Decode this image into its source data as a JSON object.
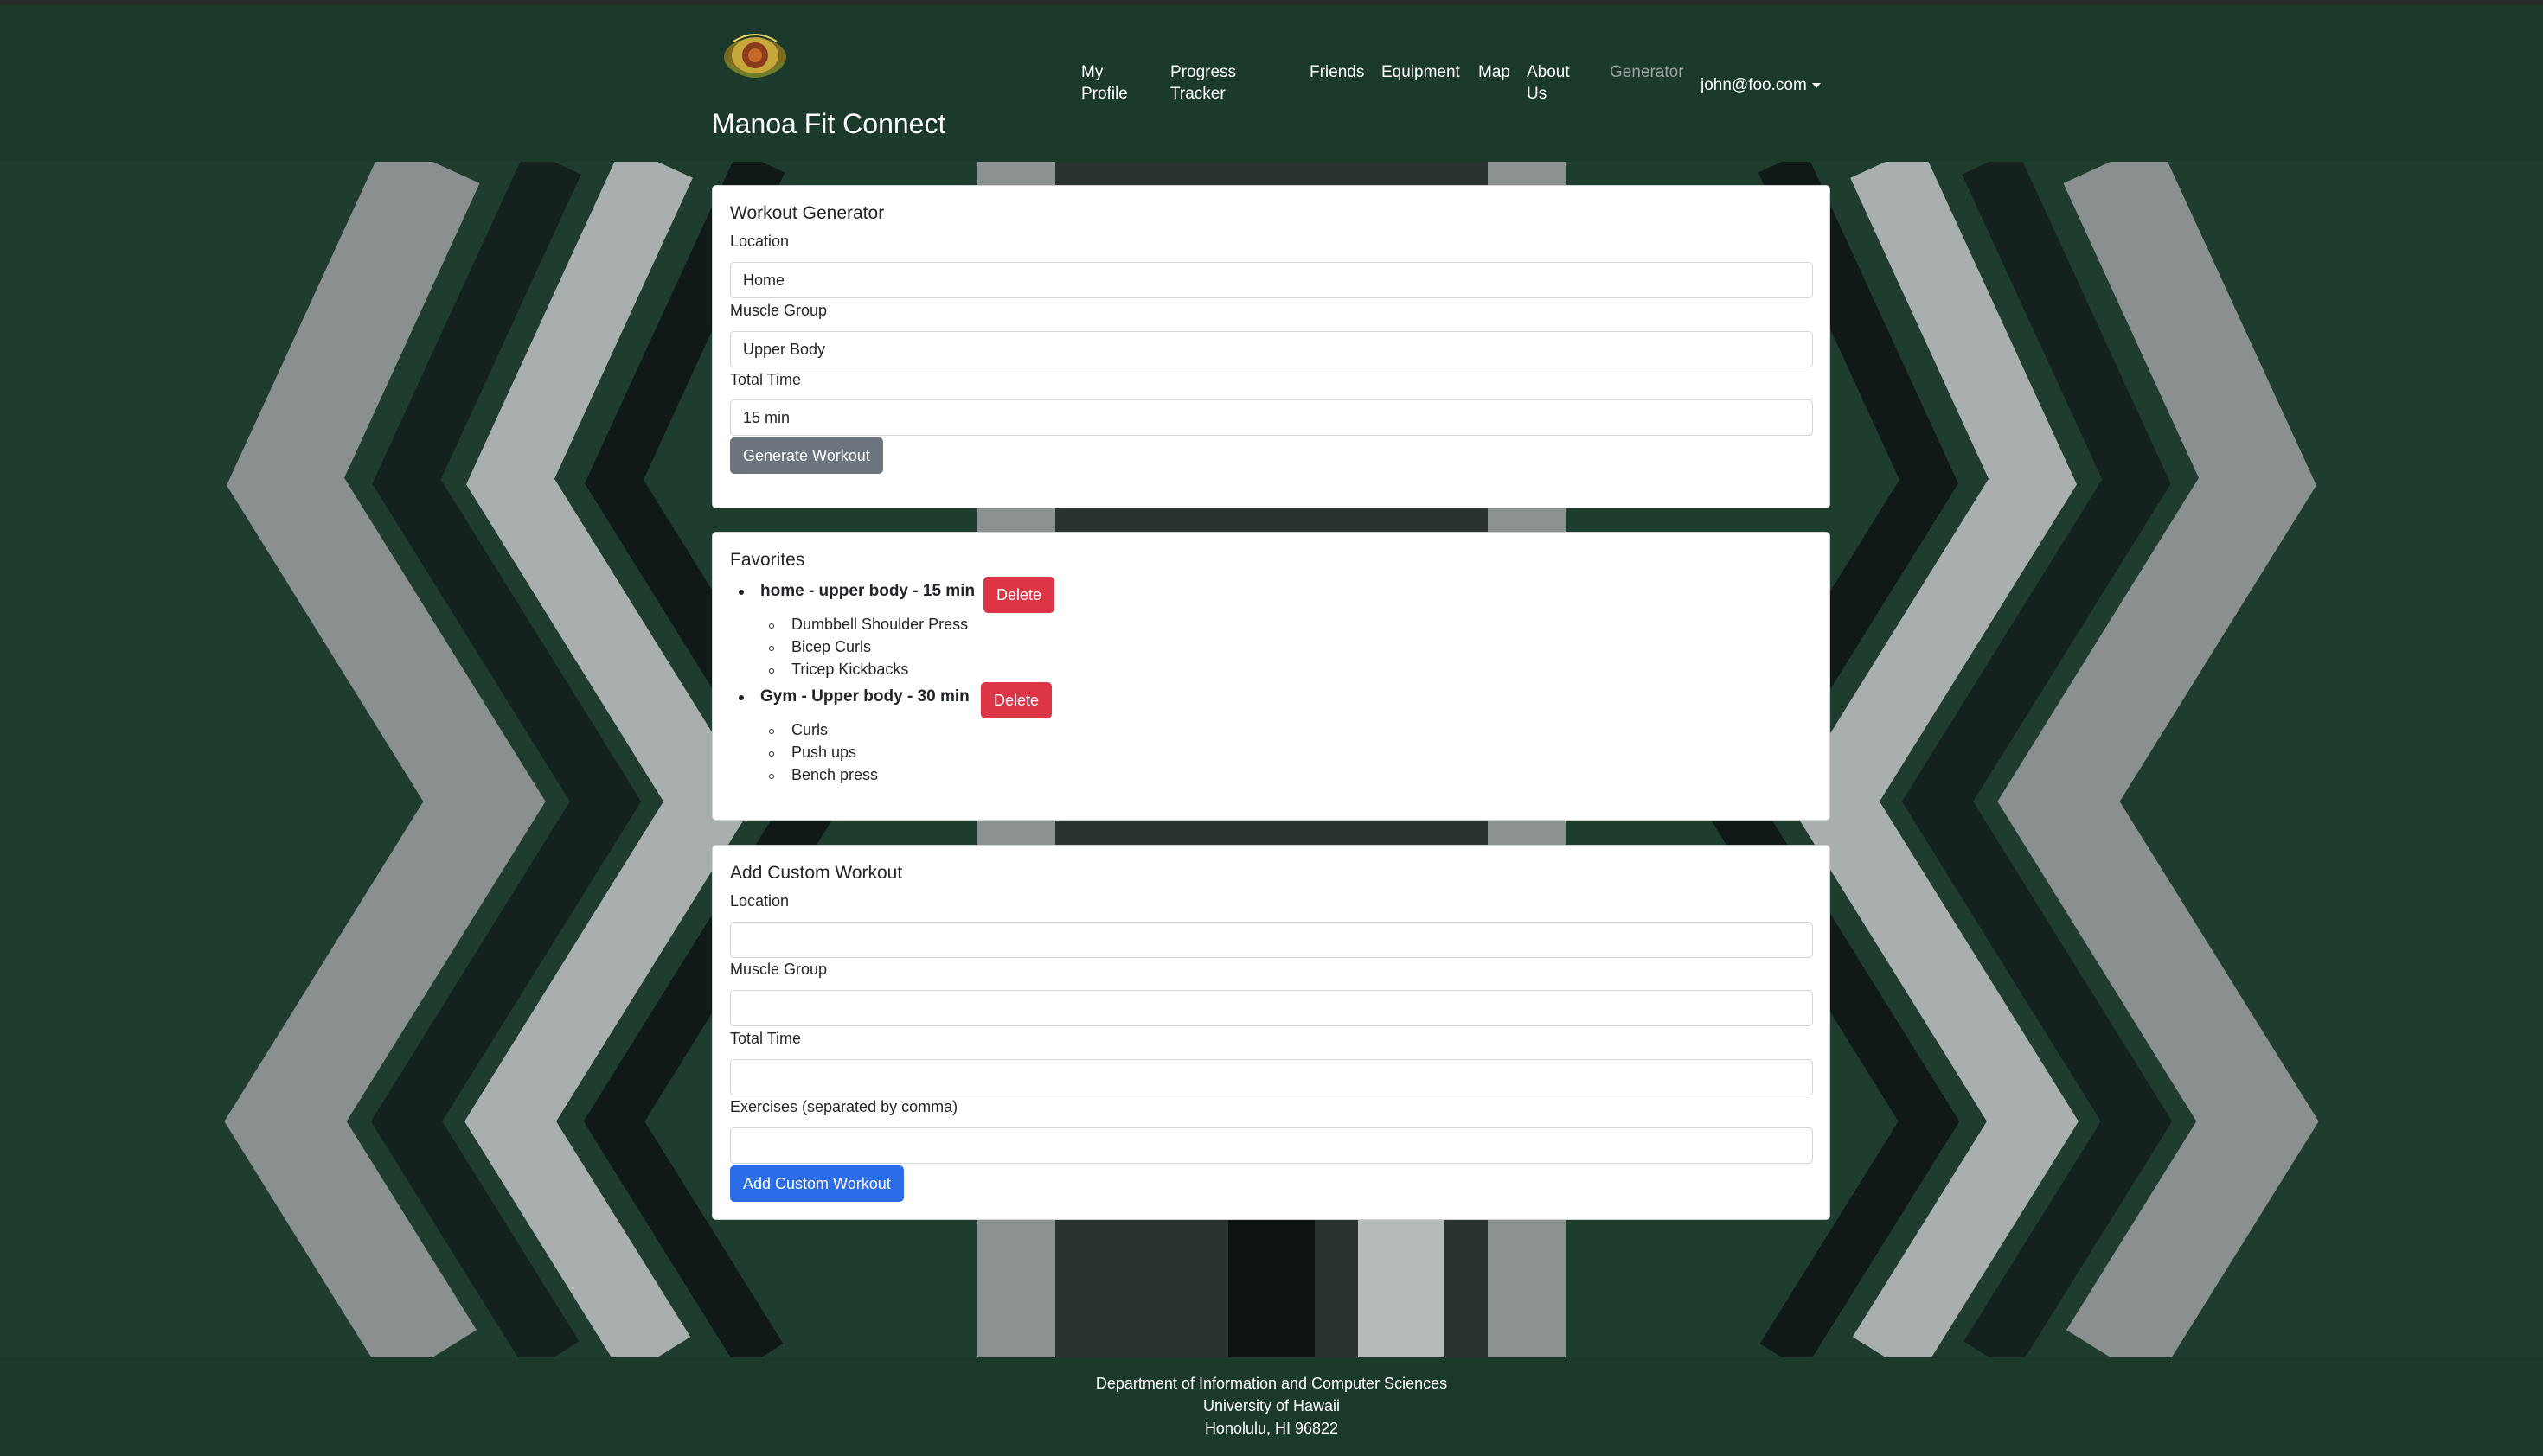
{
  "nav": {
    "brand": "Manoa Fit Connect",
    "links": [
      {
        "line1": "My",
        "line2": "Profile"
      },
      {
        "line1": "Progress",
        "line2": "Tracker"
      },
      {
        "line1": "Friends",
        "line2": ""
      },
      {
        "line1": "Equipment",
        "line2": ""
      },
      {
        "line1": "Map",
        "line2": ""
      },
      {
        "line1": "About",
        "line2": "Us"
      },
      {
        "line1": "Generator",
        "line2": ""
      }
    ],
    "user": "john@foo.com",
    "active": "Generator",
    "colors": {
      "navbar": "#1c3a2b",
      "muted_link": "#9aa3a0"
    }
  },
  "generator": {
    "title": "Workout Generator",
    "location_label": "Location",
    "location_value": "Home",
    "muscle_label": "Muscle Group",
    "muscle_value": "Upper Body",
    "time_label": "Total Time",
    "time_value": "15 min",
    "button": "Generate Workout"
  },
  "favorites": {
    "title": "Favorites",
    "items": [
      {
        "name": "home - upper body - 15 min",
        "delete": "Delete",
        "exercises": [
          "Dumbbell Shoulder Press",
          "Bicep Curls",
          "Tricep Kickbacks"
        ]
      },
      {
        "name": "Gym - Upper body - 30 min",
        "delete": "Delete",
        "exercises": [
          "Curls",
          "Push ups",
          "Bench press"
        ]
      }
    ]
  },
  "custom": {
    "title": "Add Custom Workout",
    "location_label": "Location",
    "muscle_label": "Muscle Group",
    "time_label": "Total Time",
    "exercises_label": "Exercises (separated by comma)",
    "button": "Add Custom Workout"
  },
  "footer": {
    "line1": "Department of Information and Computer Sciences",
    "line2": "University of Hawaii",
    "line3": "Honolulu, HI 96822"
  },
  "colors": {
    "primary": "#2b6de8",
    "danger": "#dc3545",
    "secondary": "#6c757d"
  }
}
